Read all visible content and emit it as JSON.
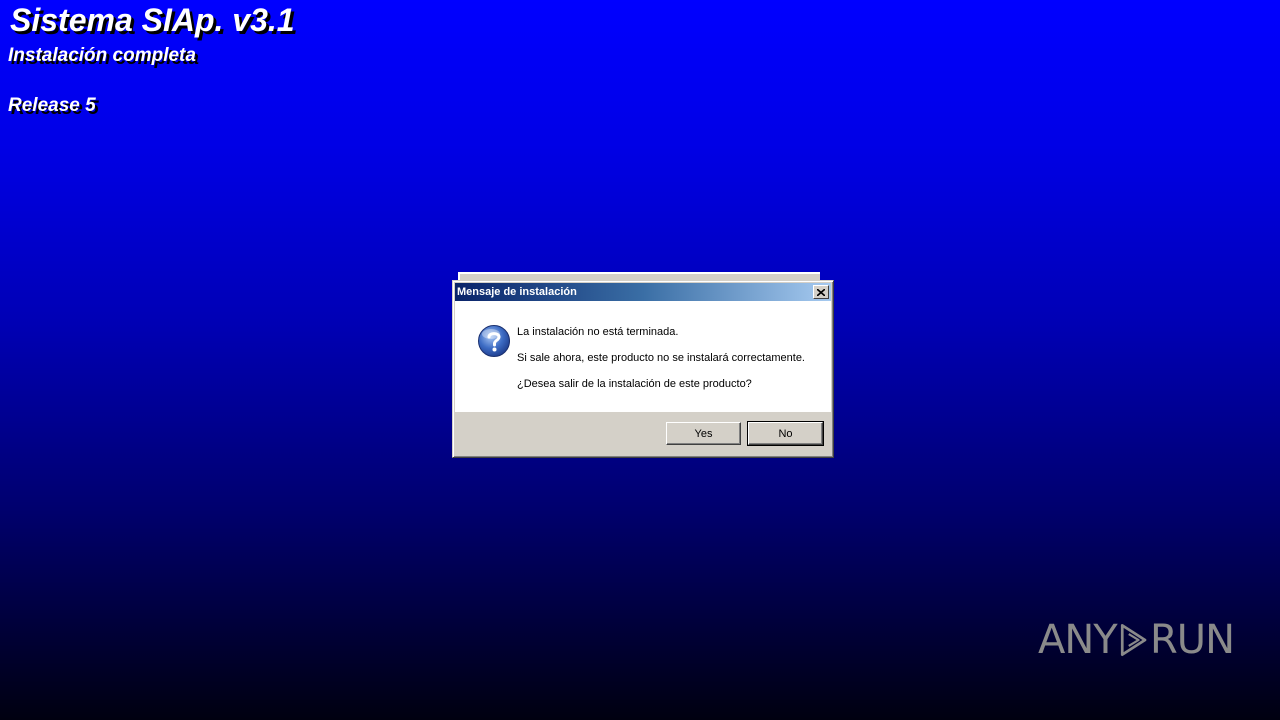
{
  "background": {
    "title": "Sistema SIAp. v3.1",
    "subtitle_1": "Instalación completa",
    "subtitle_2": "Release 5"
  },
  "dialog": {
    "title": "Mensaje de instalación",
    "close_icon": "close-icon",
    "icon": "question-icon",
    "message_line_1": "La instalación no está terminada.",
    "message_line_2": "Si sale ahora, este producto no se instalará correctamente.",
    "message_line_3": "¿Desea salir de la instalación de este producto?",
    "yes_label": "Yes",
    "no_label": "No"
  },
  "watermark": {
    "left_text": "ANY",
    "right_text": "RUN",
    "logo_icon": "play-triangle-icon"
  },
  "colors": {
    "desktop_top": "#0000ff",
    "desktop_bottom": "#000010",
    "titlebar_start": "#0a246a",
    "titlebar_end": "#a6caf0",
    "dialog_face": "#d4d0c8"
  }
}
